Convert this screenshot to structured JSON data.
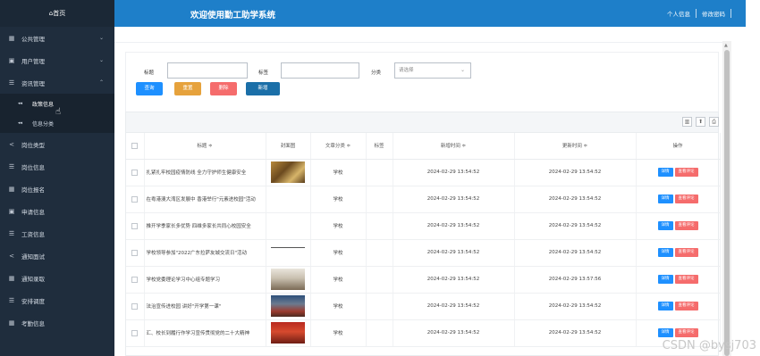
{
  "header": {
    "title": "欢迎使用勤工助学系统",
    "user_info": "个人信息",
    "change_password": "修改密码"
  },
  "sidebar": {
    "home": "首页",
    "items": [
      {
        "label": "公共管理",
        "icon": "grid-icon",
        "caret": "⌄"
      },
      {
        "label": "用户管理",
        "icon": "user-icon",
        "caret": "⌄"
      },
      {
        "label": "资讯管理",
        "icon": "list-icon",
        "caret": "⌃"
      }
    ],
    "subitems": [
      {
        "label": "政策信息",
        "icon": "double-left-icon"
      },
      {
        "label": "信息分类",
        "icon": "double-left-icon"
      }
    ],
    "items2": [
      {
        "label": "岗位类型",
        "icon": "share-icon"
      },
      {
        "label": "岗位信息",
        "icon": "list-icon"
      },
      {
        "label": "岗位报名",
        "icon": "grid-icon"
      },
      {
        "label": "申请信息",
        "icon": "doc-icon"
      },
      {
        "label": "工资信息",
        "icon": "list-icon"
      },
      {
        "label": "通知面试",
        "icon": "share-icon"
      },
      {
        "label": "通知录取",
        "icon": "grid-icon"
      },
      {
        "label": "安排调度",
        "icon": "list-icon"
      },
      {
        "label": "考勤信息",
        "icon": "grid-icon"
      }
    ]
  },
  "search": {
    "title_label": "标题",
    "tag_label": "标签",
    "category_label": "分类",
    "category_placeholder": "请选择",
    "buttons": {
      "query": "查询",
      "reset": "重置",
      "delete": "删除",
      "add": "新增"
    }
  },
  "table": {
    "headers": [
      "标题 ≑",
      "封面图",
      "文章分类 ≑",
      "标签",
      "新增时间 ≑",
      "更新时间 ≑",
      "操作"
    ],
    "rows": [
      {
        "title": "扎紧扎牢校园疫情防线 全力守护师生健康安全",
        "cover": "crowd",
        "category": "学校",
        "tag": "",
        "created": "2024-02-29 13:54:52",
        "updated": "2024-02-29 13:54:52"
      },
      {
        "title": "在粤港澳大湾区发展中 香港举行\"元素进校园\"活动",
        "cover": "blank",
        "category": "学校",
        "tag": "",
        "created": "2024-02-29 13:54:52",
        "updated": "2024-02-29 13:54:52"
      },
      {
        "title": "推开学季家长多优势 四维多家长共同心校园安全",
        "cover": "blank",
        "category": "学校",
        "tag": "",
        "created": "2024-02-29 13:54:52",
        "updated": "2024-02-29 13:54:52"
      },
      {
        "title": "学校领导参加\"2022广东拉萨友城交流日\"活动",
        "cover": "line",
        "category": "学校",
        "tag": "",
        "created": "2024-02-29 13:54:52",
        "updated": "2024-02-29 13:54:52"
      },
      {
        "title": "学校党委理论学习中心组专题学习",
        "cover": "meeting",
        "category": "学校",
        "tag": "",
        "created": "2024-02-29 13:54:52",
        "updated": "2024-02-29 13:57:56"
      },
      {
        "title": "法治宣传进校园 讲好\"开学第一课\"",
        "cover": "hall",
        "category": "学校",
        "tag": "",
        "created": "2024-02-29 13:54:52",
        "updated": "2024-02-29 13:54:52"
      },
      {
        "title": "汇、校长到履行作学习宣传贯彻党的二十大精神",
        "cover": "stage",
        "category": "学校",
        "tag": "",
        "created": "2024-02-29 13:54:52",
        "updated": "2024-02-29 13:54:52"
      }
    ],
    "action_detail": "详情",
    "action_comment": "查看评论"
  },
  "watermark": "CSDN @bysj703",
  "colors": {
    "sidebar": "#1f2d3d",
    "header": "#1e7fc9",
    "query_btn": "#1e90ff",
    "reset_btn": "#e6a23c",
    "delete_btn": "#f56c6c",
    "add_btn": "#1b6fa8"
  }
}
